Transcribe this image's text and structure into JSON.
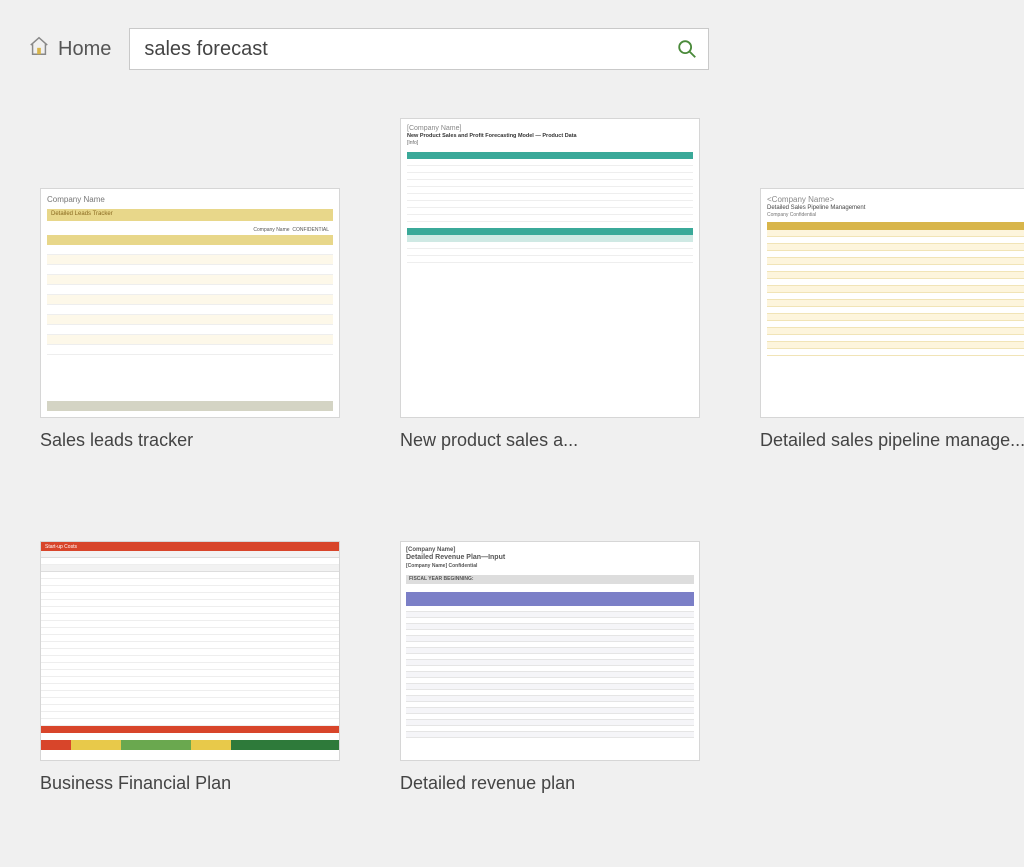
{
  "header": {
    "home_label": "Home",
    "search_value": "sales forecast"
  },
  "templates": [
    {
      "label": "Sales leads tracker"
    },
    {
      "label": "New product sales a..."
    },
    {
      "label": "Detailed sales pipeline manage..."
    },
    {
      "label": "Business Financial Plan"
    },
    {
      "label": "Detailed revenue plan"
    }
  ],
  "thumbs": {
    "t1": {
      "company": "Company Name",
      "subtitle": "Detailed Leads Tracker",
      "right1": "Company Name",
      "right2": "CONFIDENTIAL"
    },
    "t2": {
      "company": "[Company Name]",
      "subtitle": "New Product Sales and Profit Forecasting Model — Product Data",
      "tag": "[Info]"
    },
    "t3": {
      "company": "<Company Name>",
      "subtitle": "Detailed Sales Pipeline Management",
      "conf": "Company Confidential"
    },
    "t4": {
      "h1": "Start-up Costs"
    },
    "t5": {
      "company": "[Company Name]",
      "title": "Detailed Revenue Plan—Input",
      "conf": "[Company Name] Confidential",
      "fy": "FISCAL YEAR BEGINNING:"
    }
  }
}
